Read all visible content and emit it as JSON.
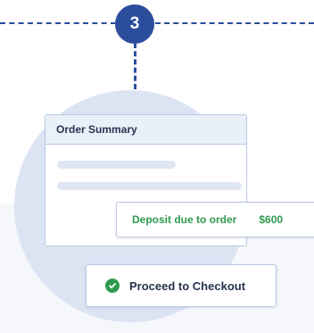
{
  "step": {
    "number": "3"
  },
  "order_summary": {
    "title": "Order Summary"
  },
  "deposit": {
    "label": "Deposit due to order",
    "amount": "$600"
  },
  "checkout": {
    "label": "Proceed to Checkout",
    "icon": "check-circle-icon"
  },
  "colors": {
    "accent": "#2b4d9c",
    "success": "#2e9a4e",
    "circle": "#dce4f4",
    "card_header": "#eaf0fa",
    "text": "#26334d"
  }
}
